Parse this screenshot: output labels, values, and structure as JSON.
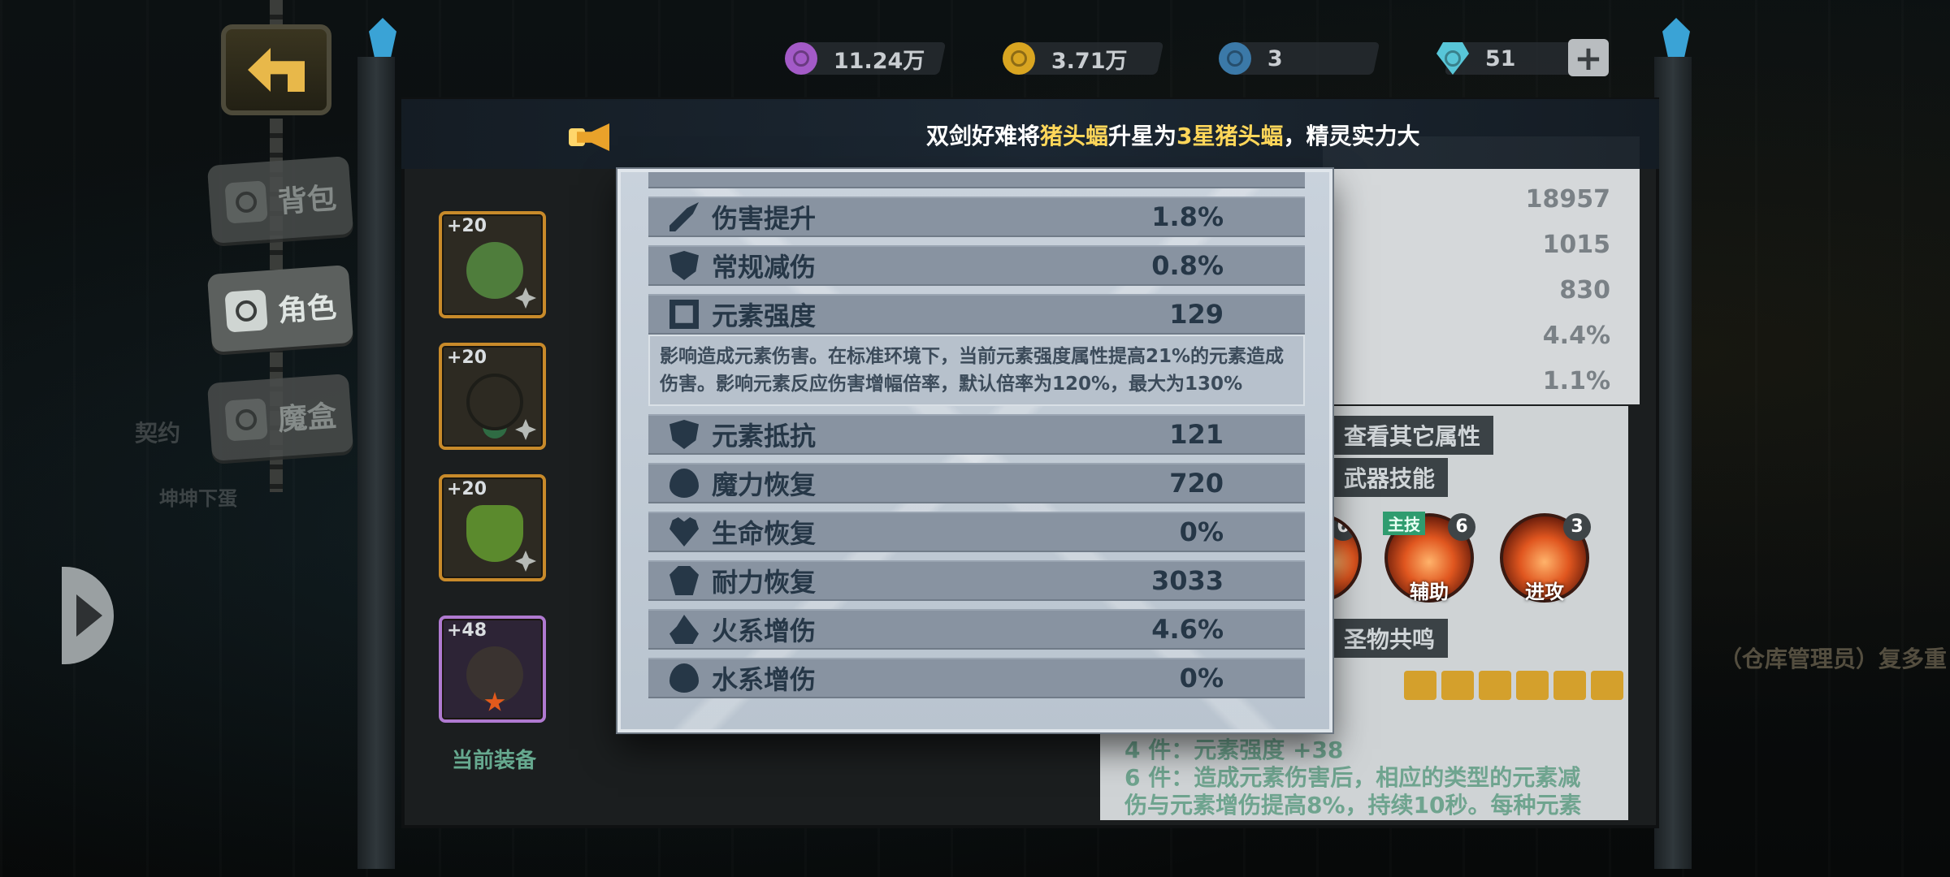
{
  "top_bar": {
    "currencies": [
      {
        "icon": "purple-gem-coin-icon",
        "value": "11.24万",
        "color": "#a35ac7"
      },
      {
        "icon": "gold-coin-icon",
        "value": "3.71万",
        "color": "#d9a521"
      },
      {
        "icon": "blue-token-icon",
        "value": "3",
        "color": "#3b79a8"
      },
      {
        "icon": "diamond-icon",
        "value": "51",
        "color": "#58c6d8"
      }
    ],
    "add_label": "+"
  },
  "side_menu": {
    "items": [
      {
        "label": "背包",
        "icon": "backpack-icon",
        "active": false
      },
      {
        "label": "角色",
        "icon": "character-icon",
        "active": true
      },
      {
        "label": "魔盒",
        "icon": "magic-box-icon",
        "active": false
      }
    ],
    "ghost_labels": [
      "契约",
      "坤坤下蛋"
    ]
  },
  "notice": {
    "icon": "megaphone-icon",
    "prefix": "双剑好难将",
    "item1": "猪头蝠",
    "mid": "升星为",
    "item2": "3星猪头蝠",
    "suffix": "，精灵实力大"
  },
  "equipment": {
    "slots": [
      {
        "level": "+20",
        "name": "green-bracer-icon",
        "color": "#4f7d3c"
      },
      {
        "level": "+20",
        "name": "pendant-necklace-icon",
        "color": "#2f6b43"
      },
      {
        "level": "+20",
        "name": "leaf-cup-icon",
        "color": "#5b8a2d"
      },
      {
        "level": "+48",
        "name": "spiky-pet-icon",
        "color": "#6a5f55"
      }
    ],
    "current_label": "当前装备"
  },
  "background_stats": {
    "values": [
      "18957",
      "1015",
      "830",
      "4.4%",
      "1.1%"
    ],
    "view_more": "查看其它属性",
    "weapon_skills": "武器技能",
    "resonance": "圣物共鸣",
    "skills": [
      {
        "label": "辅助",
        "level": "6",
        "tag": "主技"
      },
      {
        "label": "进攻",
        "level": "3",
        "tag": ""
      }
    ],
    "hidden_skill_level": "6",
    "set_lines": [
      "4 件：元素强度 +38",
      "6 件：造成元素伤害后，相应的类型的元素减",
      "伤与元素增伤提高8%，持续10秒。每种元素"
    ],
    "right_ghost": "（仓库管理员）复多重"
  },
  "stats_modal": {
    "rows": [
      {
        "icon": "sword-icon",
        "name": "伤害提升",
        "value": "1.8%"
      },
      {
        "icon": "shield-icon",
        "name": "常规减伤",
        "value": "0.8%"
      },
      {
        "icon": "element-icon",
        "name": "元素强度",
        "value": "129"
      },
      {
        "icon": "element-shield-icon",
        "name": "元素抵抗",
        "value": "121"
      },
      {
        "icon": "mana-drop-icon",
        "name": "魔力恢复",
        "value": "720"
      },
      {
        "icon": "heart-icon",
        "name": "生命恢复",
        "value": "0%"
      },
      {
        "icon": "stamina-icon",
        "name": "耐力恢复",
        "value": "3033"
      },
      {
        "icon": "fire-icon",
        "name": "火系增伤",
        "value": "4.6%"
      },
      {
        "icon": "water-drop-icon",
        "name": "水系增伤",
        "value": "0%"
      }
    ],
    "description": "影响造成元素伤害。在标准环境下，当前元素强度属性提高21%的元素造成伤害。影响元素反应伤害增幅倍率，默认倍率为120%，最大为130%"
  }
}
